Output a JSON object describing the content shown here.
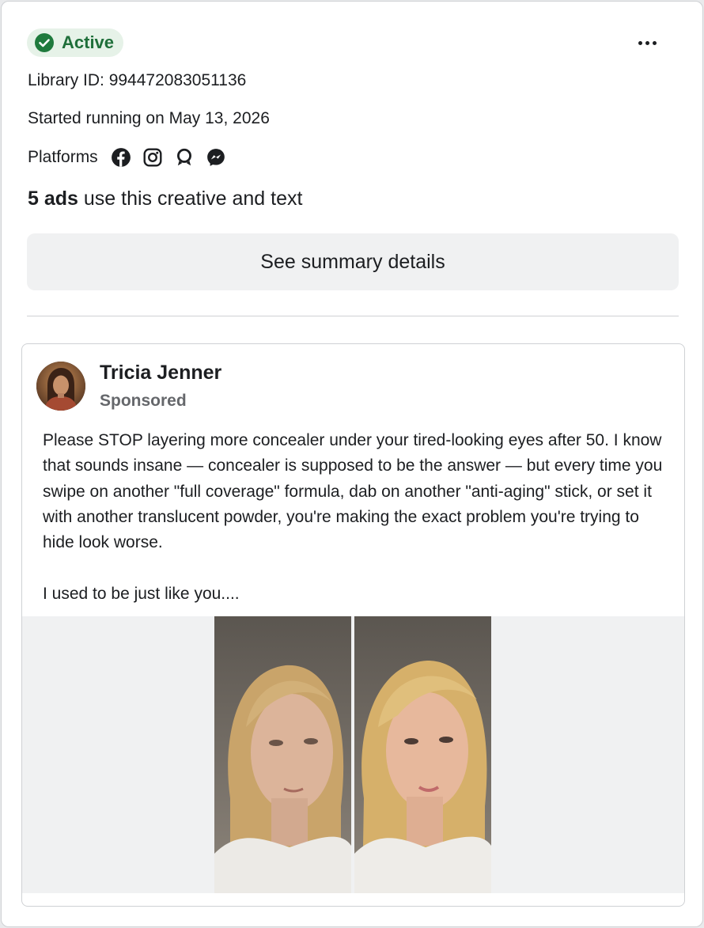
{
  "status": {
    "label": "Active",
    "color": "#1f6f3a",
    "badge_bg": "#e6f2e8",
    "icon": "check-circle-icon"
  },
  "more_menu": {
    "icon": "more-horizontal-icon"
  },
  "library": {
    "label": "Library ID:",
    "value": "994472083051136",
    "text": "Library ID: 994472083051136"
  },
  "started": {
    "text": "Started running on May 13, 2026"
  },
  "platforms": {
    "label": "Platforms",
    "icons": [
      "facebook-icon",
      "instagram-icon",
      "audience-network-icon",
      "messenger-icon"
    ]
  },
  "ads_count": {
    "count": "5 ads",
    "suffix": " use this creative and text"
  },
  "summary_button": {
    "label": "See summary details"
  },
  "ad": {
    "advertiser": "Tricia Jenner",
    "sponsored": "Sponsored",
    "body": "Please STOP layering more concealer under your tired-looking eyes after 50. I know that sounds insane — concealer is supposed to be the answer — but every time you swipe on another \"full coverage\" formula, dab on another \"anti-aging\" stick, or set it with another translucent powder, you're making the exact problem you're trying to hide look worse.\n\nI used to be just like you...."
  }
}
